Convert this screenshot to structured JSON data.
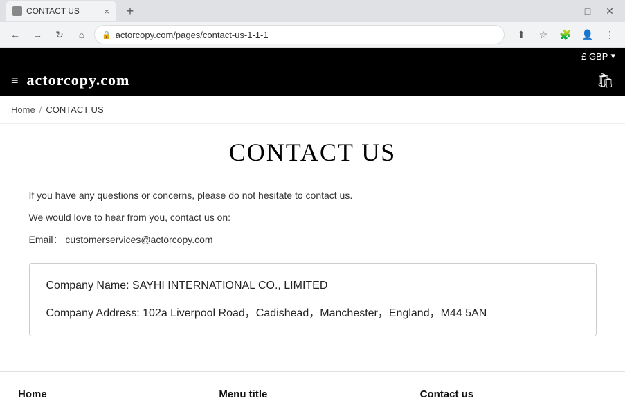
{
  "browser": {
    "tab_title": "CONTACT US",
    "url": "actorcopy.com/pages/contact-us-1-1-1",
    "new_tab_symbol": "+",
    "close_tab_symbol": "×"
  },
  "topbar": {
    "currency": "£ GBP",
    "chevron": "▾"
  },
  "header": {
    "logo": "actorcopy.com",
    "hamburger": "≡"
  },
  "breadcrumb": {
    "home": "Home",
    "separator": "/",
    "current": "CONTACT US"
  },
  "page": {
    "title": "CONTACT US",
    "intro1": "If you have any questions or concerns, please do not hesitate to contact us.",
    "intro2": "We would love to hear from you, contact us on:",
    "email_label": "Email：",
    "email_value": "customerservices@actorcopy.com",
    "company_name_label": "Company Name:  SAYHI INTERNATIONAL CO., LIMITED",
    "company_address_label": "Company Address: 102a Liverpool Road，Cadishead，Manchester，England，M44 5AN"
  },
  "footer": {
    "col1_title": "Home",
    "col2_title": "Menu title",
    "col3_title": "Contact us"
  },
  "icons": {
    "back": "←",
    "forward": "→",
    "refresh": "↻",
    "home": "⌂",
    "lock": "🔒",
    "bookmark": "☆",
    "extensions": "🧩",
    "profile": "👤",
    "menu": "⋮",
    "share": "⬆",
    "cart": "🛍",
    "window_min": "—",
    "window_max": "□",
    "window_close": "✕"
  }
}
